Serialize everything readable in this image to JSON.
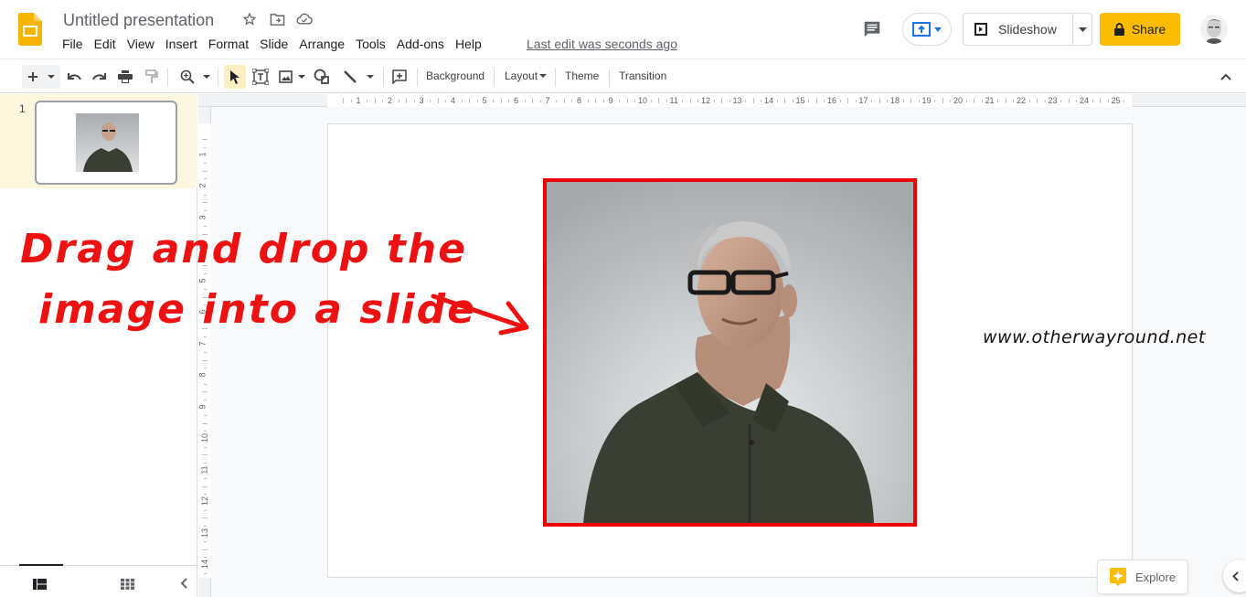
{
  "app": {
    "doc_title": "Untitled presentation",
    "last_edit": "Last edit was seconds ago"
  },
  "menu": [
    "File",
    "Edit",
    "View",
    "Insert",
    "Format",
    "Slide",
    "Arrange",
    "Tools",
    "Add-ons",
    "Help"
  ],
  "header": {
    "slideshow_label": "Slideshow",
    "share_label": "Share",
    "accent_color": "#fbbc04"
  },
  "toolbar": {
    "background_label": "Background",
    "layout_label": "Layout",
    "theme_label": "Theme",
    "transition_label": "Transition"
  },
  "filmstrip": {
    "slides": [
      {
        "number": "1"
      }
    ]
  },
  "rulers": {
    "horizontal": [
      "1",
      "2",
      "3",
      "4",
      "5",
      "6",
      "7",
      "8",
      "9",
      "10",
      "11",
      "12",
      "13",
      "14",
      "15",
      "16",
      "17",
      "18",
      "19",
      "20",
      "21",
      "22",
      "23",
      "24",
      "25"
    ],
    "vertical": [
      "1",
      "2",
      "3",
      "4",
      "5",
      "6",
      "7",
      "8",
      "9",
      "10",
      "11",
      "12",
      "13",
      "14"
    ]
  },
  "slide": {
    "watermark": "www.otherwayround.net",
    "image_border_color": "#ee0000"
  },
  "annotation": {
    "line1": "Drag and drop the",
    "line2": "image into a slide",
    "color": "#ee1111"
  },
  "explore": {
    "label": "Explore"
  }
}
